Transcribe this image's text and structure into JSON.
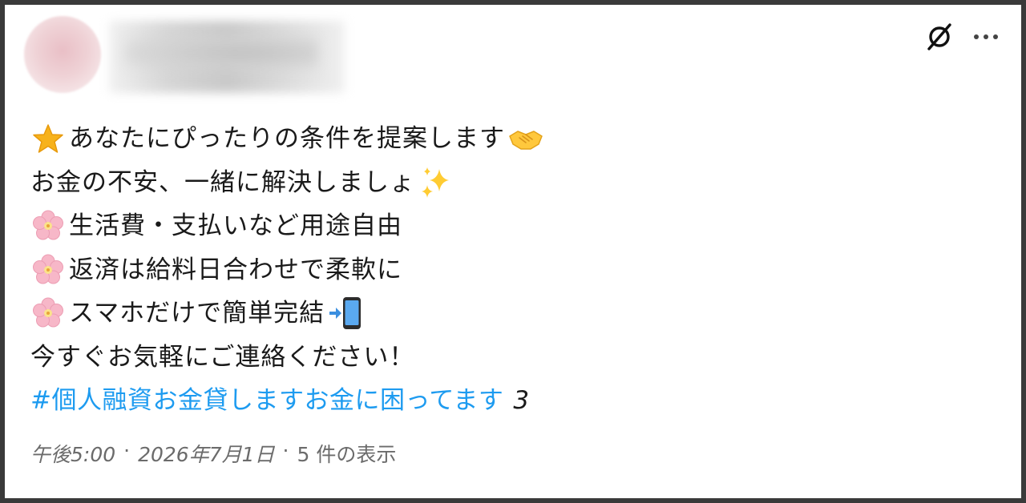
{
  "post": {
    "lines": [
      {
        "lead_icon": "star-icon",
        "text": "あなたにぴったりの条件を提案します",
        "trail_icon": "handshake-icon"
      },
      {
        "lead_icon": "",
        "text": "お金の不安、一緒に解決しましょ",
        "trail_icon": "sparkles-icon"
      },
      {
        "lead_icon": "cherry-blossom-icon",
        "text": "生活費・支払いなど用途自由",
        "trail_icon": ""
      },
      {
        "lead_icon": "cherry-blossom-icon",
        "text": "返済は給料日合わせで柔軟に",
        "trail_icon": ""
      },
      {
        "lead_icon": "cherry-blossom-icon",
        "text": "スマホだけで簡単完結",
        "trail_icon": "mobile-phone-arrow-icon"
      },
      {
        "lead_icon": "",
        "text": "今すぐお気軽にご連絡ください！",
        "trail_icon": ""
      }
    ],
    "hashtag": "#個人融資お金貸しますお金に困ってます",
    "hashtag_count": "3"
  },
  "meta": {
    "time": "午後5:00",
    "sep1": "·",
    "date": "2026年7月1日",
    "sep2": "·",
    "views": "5 件の表示"
  },
  "colors": {
    "hashtag": "#1d9bf0",
    "meta": "#6b6b6b",
    "text": "#1a1a1a"
  }
}
